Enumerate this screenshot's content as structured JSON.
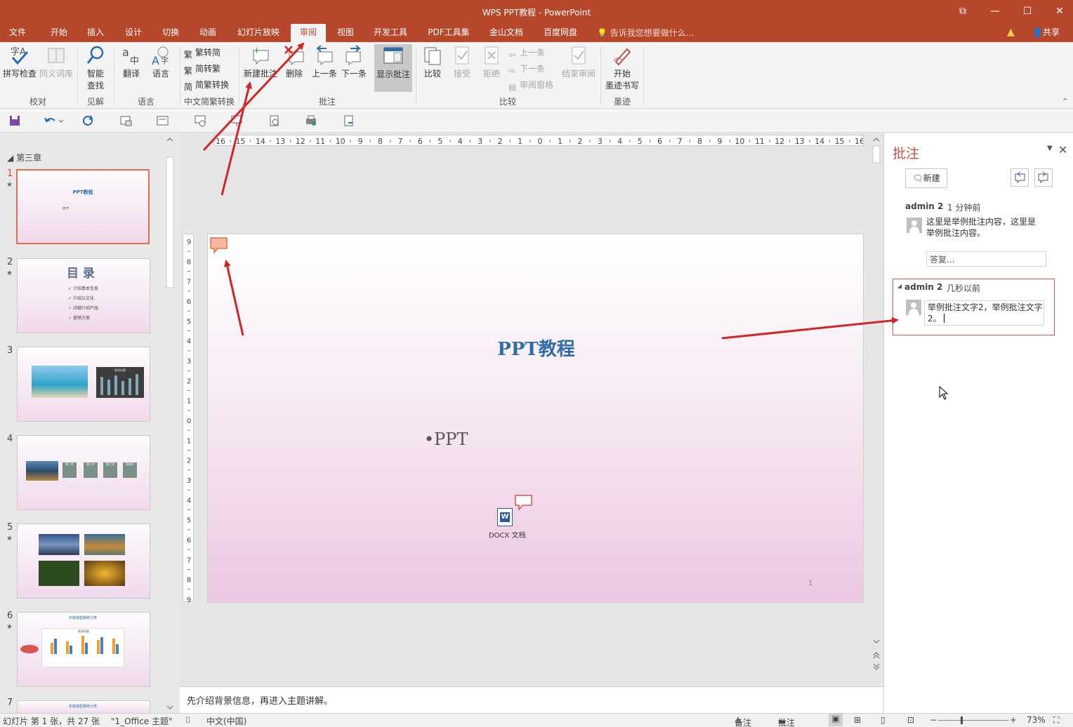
{
  "window": {
    "title": "WPS PPT教程 - PowerPoint",
    "restore_glyph": "⧉",
    "minimize_glyph": "—",
    "maximize_glyph": "☐",
    "close_glyph": "✕"
  },
  "menu": {
    "tabs": [
      "文件",
      "开始",
      "插入",
      "设计",
      "切换",
      "动画",
      "幻灯片放映",
      "审阅",
      "视图",
      "开发工具",
      "PDF工具集",
      "金山文档",
      "百度网盘"
    ],
    "active_tab": "审阅",
    "tell_me": "告诉我您想要做什么...",
    "share": "共享"
  },
  "ribbon": {
    "proofing": {
      "spellcheck": "拼写检查",
      "thesaurus": "同义词库",
      "group": "校对"
    },
    "insights": {
      "smart_lookup_1": "智能",
      "smart_lookup_2": "查找",
      "group": "见解"
    },
    "language": {
      "translate": "翻译",
      "language": "语言",
      "group": "语言"
    },
    "chinese": {
      "to_simplified": "繁转简",
      "to_traditional": "简转繁",
      "convert": "简繁转换",
      "group": "中文简繁转换"
    },
    "comments": {
      "new": "新建批注",
      "delete": "删除",
      "prev": "上一条",
      "next": "下一条",
      "show": "显示批注",
      "group": "批注"
    },
    "compare": {
      "compare": "比较",
      "accept": "接受",
      "reject": "拒绝",
      "prev": "上一条",
      "next": "下一条",
      "pane": "审阅窗格",
      "end": "结束审阅",
      "group": "比较"
    },
    "ink": {
      "start_1": "开始",
      "start_2": "墨迹书写",
      "group": "墨迹"
    }
  },
  "slides_panel": {
    "section": "第三章",
    "slides": [
      {
        "num": "1",
        "star": "★",
        "title": "PPT教程",
        "body": "PPT"
      },
      {
        "num": "2",
        "star": "★",
        "title": "目 录",
        "items": [
          "介绍基本信息",
          "介绍公文化",
          "详细介绍产品",
          "营销方案"
        ]
      },
      {
        "num": "3",
        "star": "",
        "chart_title": "图表标题"
      },
      {
        "num": "4",
        "star": "",
        "steps": [
          "第一步",
          "第二步",
          "第三步",
          "第四步"
        ]
      },
      {
        "num": "5",
        "star": "★"
      },
      {
        "num": "6",
        "star": "★",
        "title": "年度销售额统计表",
        "chart_title": "图表标题"
      },
      {
        "num": "7",
        "star": "",
        "title": "年度销售额统计表"
      }
    ]
  },
  "ruler": {
    "h_ticks": [
      "16",
      "15",
      "14",
      "13",
      "12",
      "11",
      "10",
      "9",
      "8",
      "7",
      "6",
      "5",
      "4",
      "3",
      "2",
      "1",
      "0",
      "1",
      "2",
      "3",
      "4",
      "5",
      "6",
      "7",
      "8",
      "9",
      "10",
      "11",
      "12",
      "13",
      "14",
      "15",
      "16"
    ],
    "v_ticks": [
      "9",
      "8",
      "7",
      "6",
      "5",
      "4",
      "3",
      "2",
      "1",
      "0",
      "1",
      "2",
      "3",
      "4",
      "5",
      "6",
      "7",
      "8",
      "9"
    ]
  },
  "slide": {
    "title": "PPT教程",
    "bullet": "•PPT",
    "page_number": "1",
    "attachment_label": "DOCX 文档",
    "attachment_glyph": "W"
  },
  "notes": "先介绍背景信息，再进入主题讲解。",
  "comments_pane": {
    "title": "批注",
    "new_button": "新建",
    "comments": [
      {
        "author": "admin 2",
        "time": "1 分钟前",
        "text_line1": "这里是举例批注内容，这里是",
        "text_line2": "举例批注内容。",
        "reply_placeholder": "答复..."
      },
      {
        "author": "admin 2",
        "time": "几秒以前",
        "text_line1": "举例批注文字2，举例批注文字",
        "text_line2": "2。"
      }
    ]
  },
  "status": {
    "slide_info": "幻灯片 第 1 张，共 27 张",
    "theme": "\"1_Office 主题\"",
    "language": "中文(中国)",
    "notes": "备注",
    "comments": "批注",
    "zoom": "73%"
  },
  "colors": {
    "accent": "#b7472a",
    "title_blue": "#2e6ea6",
    "arrow": "#d22525",
    "comment_border": "#d9534f"
  }
}
